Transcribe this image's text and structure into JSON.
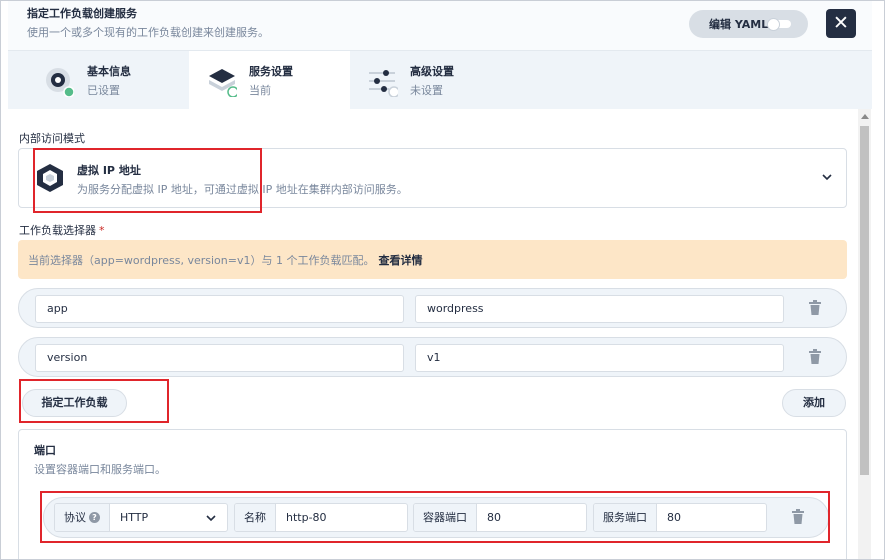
{
  "header": {
    "title": "指定工作负载创建服务",
    "description": "使用一个或多个现有的工作负载创建来创建服务。",
    "edit_yaml_label": "编辑 YAML",
    "close_symbol": "✕"
  },
  "tabs": [
    {
      "label": "基本信息",
      "status": "已设置",
      "icon": "basic-info-icon"
    },
    {
      "label": "服务设置",
      "status": "当前",
      "icon": "service-settings-icon"
    },
    {
      "label": "高级设置",
      "status": "未设置",
      "icon": "advanced-settings-icon"
    }
  ],
  "access_mode": {
    "label": "内部访问模式",
    "selected_title": "虚拟 IP 地址",
    "selected_desc": "为服务分配虚拟 IP 地址，可通过虚拟 IP 地址在集群内部访问服务。",
    "icon": "cube-icon"
  },
  "selector": {
    "label": "工作负载选择器",
    "required_mark": "*",
    "alert_text": "当前选择器（app=wordpress, version=v1）与 1 个工作负载匹配。",
    "alert_link": "查看详情",
    "rows": [
      {
        "key": "app",
        "value": "wordpress"
      },
      {
        "key": "version",
        "value": "v1"
      }
    ],
    "specify_button": "指定工作负载",
    "add_button": "添加"
  },
  "ports": {
    "title": "端口",
    "description": "设置容器端口和服务端口。",
    "rows": [
      {
        "protocol_label": "协议",
        "protocol_help": "?",
        "protocol_value": "HTTP",
        "name_label": "名称",
        "name_value": "http-80",
        "container_port_label": "容器端口",
        "container_port_value": "80",
        "service_port_label": "服务端口",
        "service_port_value": "80"
      }
    ]
  },
  "colors": {
    "accent_dark": "#242e42",
    "success_green": "#55bc8a",
    "highlight_red": "#e0252b",
    "alert_bg": "#fde6c7"
  }
}
